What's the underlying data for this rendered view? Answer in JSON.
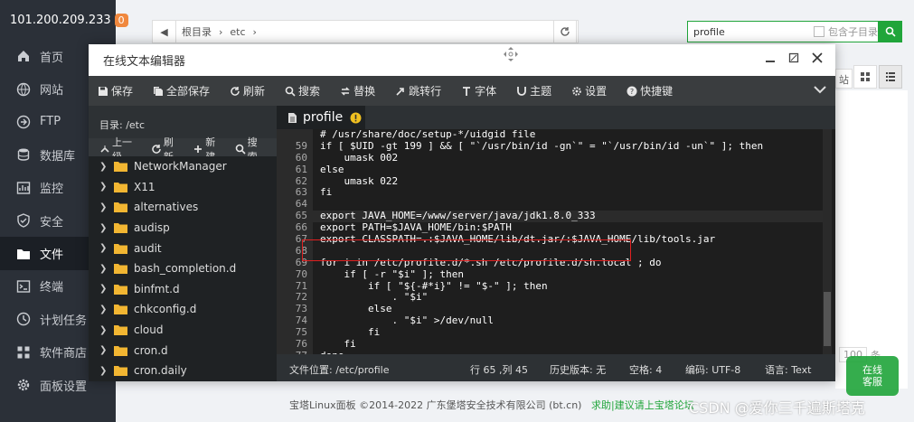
{
  "server": {
    "ip": "101.200.209.233",
    "badge": "0"
  },
  "sidebar": {
    "items": [
      {
        "label": "首页",
        "icon": "home-icon"
      },
      {
        "label": "网站",
        "icon": "globe-icon"
      },
      {
        "label": "FTP",
        "icon": "ftp-icon"
      },
      {
        "label": "数据库",
        "icon": "database-icon"
      },
      {
        "label": "监控",
        "icon": "monitor-icon"
      },
      {
        "label": "安全",
        "icon": "shield-icon"
      },
      {
        "label": "文件",
        "icon": "folder-icon",
        "active": true
      },
      {
        "label": "终端",
        "icon": "terminal-icon"
      },
      {
        "label": "计划任务",
        "icon": "clock-icon"
      },
      {
        "label": "软件商店",
        "icon": "store-icon"
      },
      {
        "label": "面板设置",
        "icon": "gear-icon"
      }
    ]
  },
  "filemanager": {
    "breadcrumb": [
      "根目录",
      "etc"
    ],
    "search_value": "profile",
    "subdir_label": "包含子目录",
    "site_label": "站",
    "pager_size": "100",
    "pager_suffix": "条"
  },
  "editor": {
    "title": "在线文本编辑器",
    "toolbar": [
      {
        "label": "保存",
        "icon": "save-icon"
      },
      {
        "label": "全部保存",
        "icon": "save-all-icon"
      },
      {
        "label": "刷新",
        "icon": "refresh-icon"
      },
      {
        "label": "搜索",
        "icon": "search-icon"
      },
      {
        "label": "替换",
        "icon": "replace-icon"
      },
      {
        "label": "跳转行",
        "icon": "goto-icon"
      },
      {
        "label": "字体",
        "icon": "font-icon"
      },
      {
        "label": "主题",
        "icon": "theme-icon"
      },
      {
        "label": "设置",
        "icon": "settings-icon"
      },
      {
        "label": "快捷键",
        "icon": "help-icon"
      }
    ],
    "dir_path": "目录: /etc",
    "file_tools": [
      {
        "label": "上一级",
        "icon": "up-arrow-icon"
      },
      {
        "label": "刷新",
        "icon": "refresh-icon"
      },
      {
        "label": "新建",
        "icon": "plus-icon"
      },
      {
        "label": "搜索",
        "icon": "search-icon"
      }
    ],
    "tree": [
      "NetworkManager",
      "X11",
      "alternatives",
      "audisp",
      "audit",
      "bash_completion.d",
      "binfmt.d",
      "chkconfig.d",
      "cloud",
      "cron.d",
      "cron.daily"
    ],
    "tab_name": "profile",
    "code": [
      {
        "n": "",
        "t": "# /usr/share/doc/setup-*/uidgid file"
      },
      {
        "n": "59",
        "t": "if [ $UID -gt 199 ] && [ \"`/usr/bin/id -gn`\" = \"`/usr/bin/id -un`\" ]; then"
      },
      {
        "n": "60",
        "t": "    umask 002"
      },
      {
        "n": "61",
        "t": "else"
      },
      {
        "n": "62",
        "t": "    umask 022"
      },
      {
        "n": "63",
        "t": "fi"
      },
      {
        "n": "64",
        "t": ""
      },
      {
        "n": "65",
        "t": "export JAVA_HOME=/www/server/java/jdk1.8.0_333"
      },
      {
        "n": "66",
        "t": "export PATH=$JAVA_HOME/bin:$PATH"
      },
      {
        "n": "67",
        "t": "export CLASSPATH=.:$JAVA_HOME/lib/dt.jar/:$JAVA_HOME/lib/tools.jar"
      },
      {
        "n": "68",
        "t": ""
      },
      {
        "n": "69",
        "t": "for i in /etc/profile.d/*.sh /etc/profile.d/sh.local ; do"
      },
      {
        "n": "70",
        "t": "    if [ -r \"$i\" ]; then"
      },
      {
        "n": "71",
        "t": "        if [ \"${-#*i}\" != \"$-\" ]; then"
      },
      {
        "n": "72",
        "t": "            . \"$i\""
      },
      {
        "n": "73",
        "t": "        else"
      },
      {
        "n": "74",
        "t": "            . \"$i\" >/dev/null"
      },
      {
        "n": "75",
        "t": "        fi"
      },
      {
        "n": "76",
        "t": "    fi"
      },
      {
        "n": "77",
        "t": "done"
      }
    ],
    "status": {
      "path": "文件位置: /etc/profile",
      "cursor": "行 65 ,列 45",
      "history": "历史版本: 无",
      "spaces": "空格: 4",
      "encoding": "编码: UTF-8",
      "language": "语言: Text"
    }
  },
  "footer": {
    "copyright": "宝塔Linux面板 ©2014-2022 广东堡塔安全技术有限公司 (bt.cn)",
    "links": "求助|建议请上宝塔论坛"
  },
  "watermark": "CSDN @爱你三千遍斯塔克",
  "kefu": "在线\n客服",
  "colors": {
    "accent": "#20a53a",
    "sidebar": "#2b3038",
    "editor_bg": "#1e1e1e",
    "highlight_box": "#e02020"
  }
}
